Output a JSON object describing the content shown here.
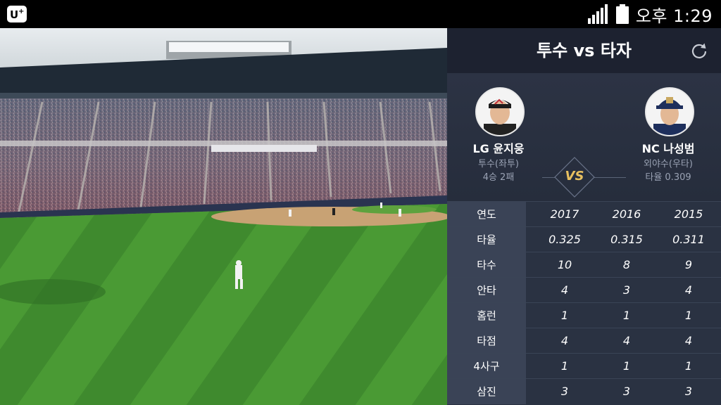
{
  "status_bar": {
    "time": "오후 1:29",
    "app_logo_icon": "uplus-logo-icon",
    "signal_icon": "signal-strength-icon",
    "battery_icon": "battery-icon"
  },
  "panel": {
    "title": "투수 vs 타자",
    "refresh_icon": "refresh-icon",
    "pitcher": {
      "name": "LG 윤지웅",
      "position": "투수(좌투)",
      "record": "4승 2패"
    },
    "batter": {
      "name": "NC 나성범",
      "position": "외야수(우타)",
      "record": "타율 0.309"
    },
    "vs_label": "VS",
    "stats": {
      "header": {
        "label": "연도",
        "values": [
          "2017",
          "2016",
          "2015"
        ]
      },
      "rows": [
        {
          "label": "타율",
          "values": [
            "0.325",
            "0.315",
            "0.311"
          ]
        },
        {
          "label": "타수",
          "values": [
            "10",
            "8",
            "9"
          ]
        },
        {
          "label": "안타",
          "values": [
            "4",
            "3",
            "4"
          ]
        },
        {
          "label": "홈런",
          "values": [
            "1",
            "1",
            "1"
          ]
        },
        {
          "label": "타점",
          "values": [
            "4",
            "4",
            "4"
          ]
        },
        {
          "label": "4사구",
          "values": [
            "1",
            "1",
            "1"
          ]
        },
        {
          "label": "삼진",
          "values": [
            "3",
            "3",
            "3"
          ]
        }
      ]
    }
  },
  "colors": {
    "panel_bg": "#2a3242",
    "header_bg": "#1d2230",
    "vs_accent": "#e8c060",
    "field_green": "#3f8a2e"
  }
}
